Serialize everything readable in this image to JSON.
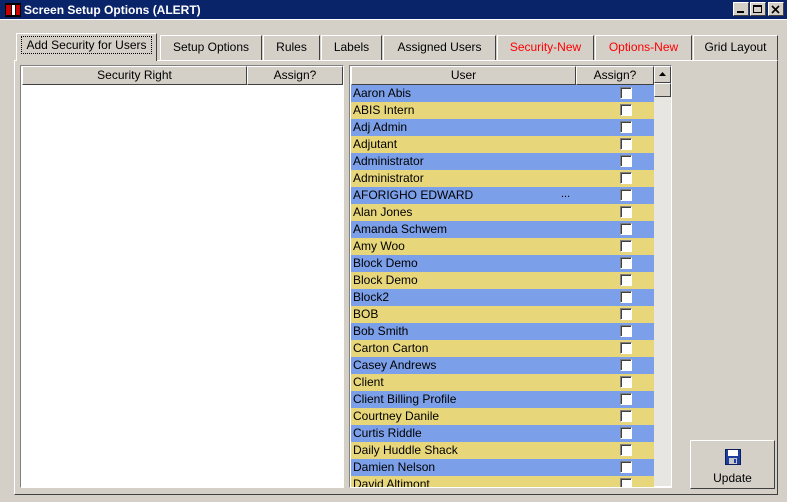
{
  "window": {
    "title": "Screen Setup Options (ALERT)"
  },
  "tabs": [
    {
      "label": "Add Security for Users",
      "active": true
    },
    {
      "label": "Setup Options"
    },
    {
      "label": "Rules"
    },
    {
      "label": "Labels"
    },
    {
      "label": "Assigned Users"
    },
    {
      "label": "Security-New",
      "color": "#ff0000"
    },
    {
      "label": "Options-New",
      "color": "#ff0000"
    },
    {
      "label": "Grid Layout"
    }
  ],
  "security_grid": {
    "headers": [
      "Security Right",
      "Assign?"
    ]
  },
  "users_grid": {
    "headers": [
      "User",
      "Assign?"
    ],
    "row_colors": [
      "#7b9fe8",
      "#e8d67b"
    ],
    "rows": [
      {
        "name": "Aaron Abis",
        "assigned": false
      },
      {
        "name": "ABIS Intern",
        "assigned": false
      },
      {
        "name": "Adj Admin",
        "assigned": false
      },
      {
        "name": "Adjutant",
        "assigned": false
      },
      {
        "name": "Administrator",
        "assigned": false
      },
      {
        "name": "Administrator",
        "assigned": false
      },
      {
        "name": "AFORIGHO EDWARD",
        "suffix": "...",
        "assigned": false
      },
      {
        "name": "Alan Jones",
        "assigned": false
      },
      {
        "name": "Amanda Schwem",
        "assigned": false
      },
      {
        "name": "Amy Woo",
        "assigned": false
      },
      {
        "name": "Block   Demo",
        "assigned": false
      },
      {
        "name": "Block   Demo",
        "assigned": false
      },
      {
        "name": "Block2",
        "assigned": false
      },
      {
        "name": "BOB",
        "assigned": false
      },
      {
        "name": "Bob Smith",
        "assigned": false
      },
      {
        "name": "Carton Carton",
        "assigned": false
      },
      {
        "name": "Casey Andrews",
        "assigned": false
      },
      {
        "name": "Client",
        "assigned": false
      },
      {
        "name": "Client Billing Profile",
        "assigned": false
      },
      {
        "name": "Courtney Danile",
        "assigned": false
      },
      {
        "name": "Curtis  Riddle",
        "assigned": false
      },
      {
        "name": "Daily Huddle Shack",
        "assigned": false
      },
      {
        "name": "Damien Nelson",
        "assigned": false
      },
      {
        "name": "David Altimont",
        "assigned": false
      }
    ]
  },
  "update_button": {
    "label": "Update",
    "icon": "floppy-disk-icon"
  },
  "colors": {
    "titlebar": "#0a246a",
    "face": "#d4d0c8",
    "accent_red": "#ff0000"
  }
}
